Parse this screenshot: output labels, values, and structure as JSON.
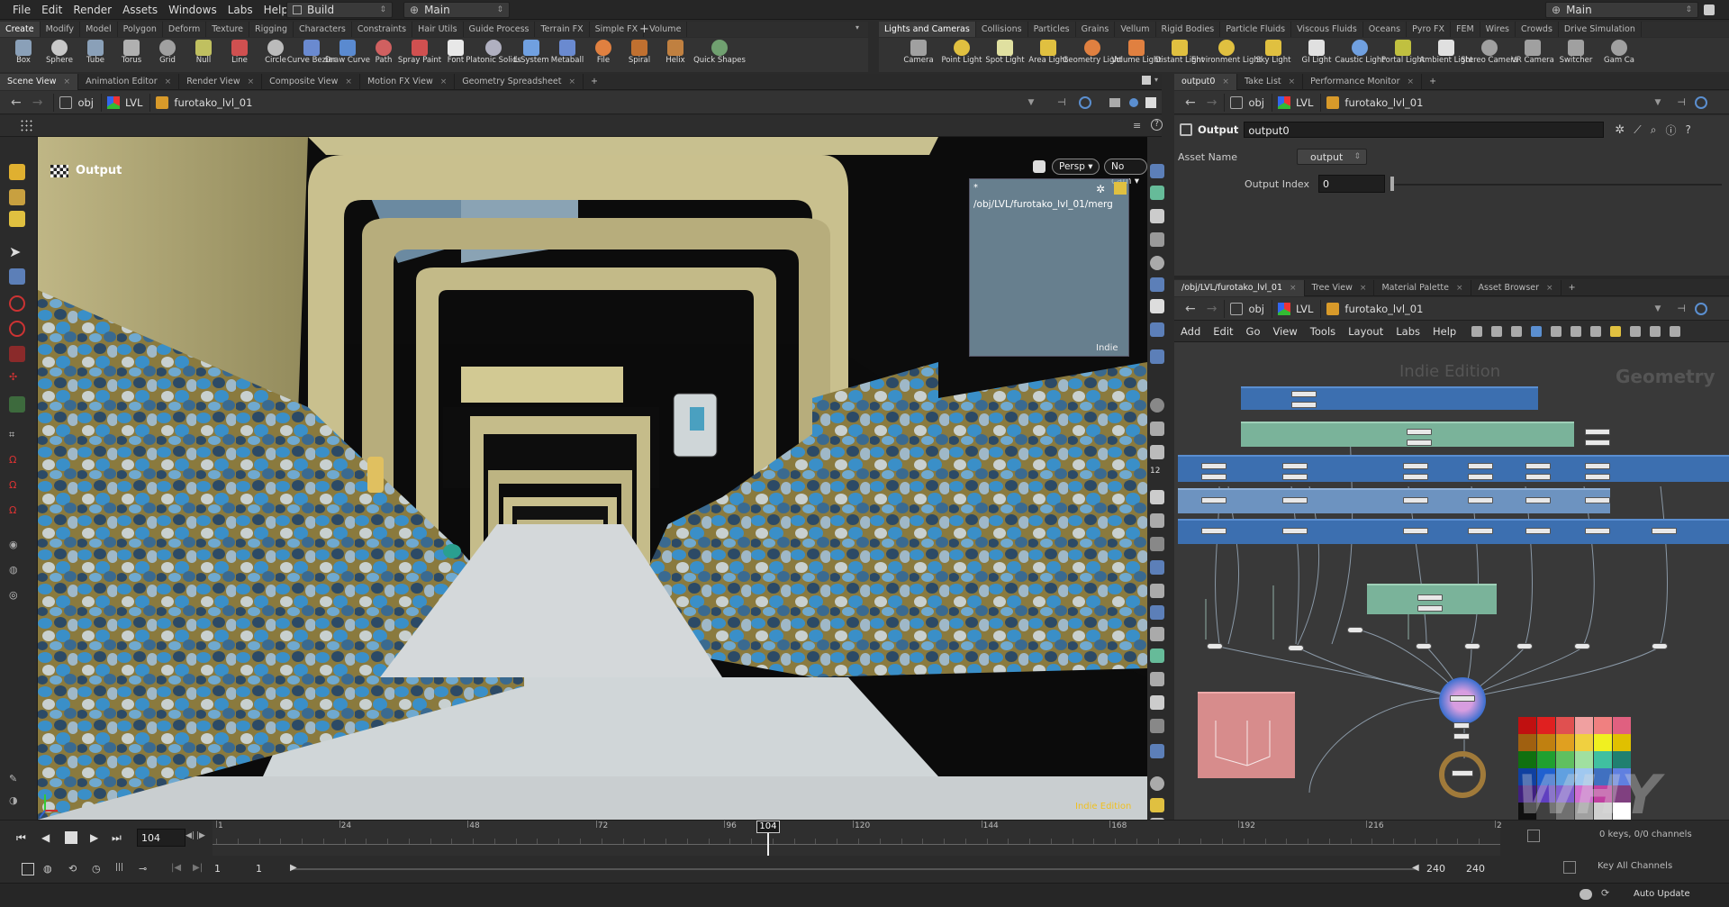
{
  "menu": {
    "items": [
      "File",
      "Edit",
      "Render",
      "Assets",
      "Windows",
      "Labs",
      "Help"
    ],
    "desktop": "Build",
    "context": "Main",
    "right_desktop": "Main"
  },
  "left_shelf": {
    "tabs": [
      "Create",
      "Modify",
      "Model",
      "Polygon",
      "Deform",
      "Texture",
      "Rigging",
      "Characters",
      "Constraints",
      "Hair Utils",
      "Guide Process",
      "Terrain FX",
      "Simple FX",
      "Volume"
    ],
    "tools": [
      {
        "label": "Box",
        "icon": "box-icon"
      },
      {
        "label": "Sphere",
        "icon": "sphere-icon"
      },
      {
        "label": "Tube",
        "icon": "tube-icon"
      },
      {
        "label": "Torus",
        "icon": "torus-icon"
      },
      {
        "label": "Grid",
        "icon": "grid-icon"
      },
      {
        "label": "Null",
        "icon": "null-icon"
      },
      {
        "label": "Line",
        "icon": "line-icon"
      },
      {
        "label": "Circle",
        "icon": "circle-icon"
      },
      {
        "label": "Curve Bezier",
        "icon": "curve-bezier-icon"
      },
      {
        "label": "Draw Curve",
        "icon": "draw-curve-icon"
      },
      {
        "label": "Path",
        "icon": "path-icon"
      },
      {
        "label": "Spray Paint",
        "icon": "spray-paint-icon"
      },
      {
        "label": "Font",
        "icon": "font-icon"
      },
      {
        "label": "Platonic Solids",
        "icon": "platonic-icon"
      },
      {
        "label": "L-System",
        "icon": "lsystem-icon"
      },
      {
        "label": "Metaball",
        "icon": "metaball-icon"
      },
      {
        "label": "File",
        "icon": "file-icon"
      },
      {
        "label": "Spiral",
        "icon": "spiral-icon"
      },
      {
        "label": "Helix",
        "icon": "helix-icon"
      },
      {
        "label": "Quick Shapes",
        "icon": "quick-shapes-icon"
      }
    ]
  },
  "right_shelf": {
    "tabs": [
      "Lights and Cameras",
      "Collisions",
      "Particles",
      "Grains",
      "Vellum",
      "Rigid Bodies",
      "Particle Fluids",
      "Viscous Fluids",
      "Oceans",
      "Pyro FX",
      "FEM",
      "Wires",
      "Crowds",
      "Drive Simulation"
    ],
    "tools": [
      {
        "label": "Camera",
        "icon": "camera-icon"
      },
      {
        "label": "Point Light",
        "icon": "point-light-icon"
      },
      {
        "label": "Spot Light",
        "icon": "spot-light-icon"
      },
      {
        "label": "Area Light",
        "icon": "area-light-icon"
      },
      {
        "label": "Geometry Light",
        "icon": "geometry-light-icon"
      },
      {
        "label": "Volume Light",
        "icon": "volume-light-icon"
      },
      {
        "label": "Distant Light",
        "icon": "distant-light-icon"
      },
      {
        "label": "Environment Light",
        "icon": "environment-light-icon"
      },
      {
        "label": "Sky Light",
        "icon": "sky-light-icon"
      },
      {
        "label": "GI Light",
        "icon": "gi-light-icon"
      },
      {
        "label": "Caustic Light",
        "icon": "caustic-light-icon"
      },
      {
        "label": "Portal Light",
        "icon": "portal-light-icon"
      },
      {
        "label": "Ambient Light",
        "icon": "ambient-light-icon"
      },
      {
        "label": "Stereo Camera",
        "icon": "stereo-camera-icon"
      },
      {
        "label": "VR Camera",
        "icon": "vr-camera-icon"
      },
      {
        "label": "Switcher",
        "icon": "switcher-icon"
      },
      {
        "label": "Gam Ca",
        "icon": "gamepad-camera-icon"
      }
    ]
  },
  "viewer": {
    "tabs": [
      "Scene View",
      "Animation Editor",
      "Render View",
      "Composite View",
      "Motion FX View",
      "Geometry Spreadsheet"
    ],
    "path": [
      "obj",
      "LVL",
      "furotako_lvl_01"
    ],
    "title": "Output",
    "persp": "Persp ▾",
    "cam": "No cam ▾",
    "overlay_field": "*",
    "overlay_path": "/obj/LVL/furotako_lvl_01/merg",
    "overlay_badge": "Indie",
    "edition": "Indie Edition"
  },
  "params": {
    "tabs": [
      "output0",
      "Take List",
      "Performance Monitor"
    ],
    "path": [
      "obj",
      "LVL",
      "furotako_lvl_01"
    ],
    "node_type": "Output",
    "node_name": "output0",
    "asset_label": "Asset Name",
    "asset_value": "output",
    "index_label": "Output Index",
    "index_value": "0"
  },
  "network": {
    "tabs": [
      "/obj/LVL/furotako_lvl_01",
      "Tree View",
      "Material Palette",
      "Asset Browser"
    ],
    "path": [
      "obj",
      "LVL",
      "furotako_lvl_01"
    ],
    "menu": [
      "Add",
      "Edit",
      "Go",
      "View",
      "Tools",
      "Layout",
      "Labs",
      "Help"
    ],
    "watermark": "Indie Edition",
    "context_label": "Geometry"
  },
  "timeline": {
    "frame": "104",
    "marker": "104",
    "ticks": [
      "1",
      "24",
      "48",
      "72",
      "96",
      "120",
      "144",
      "168",
      "192",
      "216",
      "2"
    ],
    "start": "1",
    "start2": "1",
    "end": "240",
    "end2": "240",
    "keys_info": "0 keys, 0/0 channels",
    "key_all": "Key All Channels",
    "auto_update": "Auto Update",
    "progress": 0.43
  },
  "colors": {
    "accent": "#f0c020",
    "group_blue": "#3c6fb0",
    "group_green": "#7ab39a",
    "group_pink": "#d78c8c",
    "sky": "#6b8aa1",
    "wall": "#c8bf8d"
  },
  "palette": [
    "#c01010",
    "#e02020",
    "#e05050",
    "#f0a0a0",
    "#f08080",
    "#e06080",
    "#a06010",
    "#c08010",
    "#e0a020",
    "#f0d040",
    "#f0f020",
    "#e0c000",
    "#107010",
    "#20a030",
    "#60c060",
    "#a0e0a0",
    "#40c0a0",
    "#208070",
    "#1040a0",
    "#2060d0",
    "#60a0e0",
    "#a0c8f0",
    "#4070c0",
    "#6080e0",
    "#402080",
    "#6040c0",
    "#8060d0",
    "#d070d0",
    "#c040a0",
    "#804080",
    "#101010",
    "#404040",
    "#707070",
    "#a0a0a0",
    "#d0d0d0",
    "#ffffff"
  ]
}
